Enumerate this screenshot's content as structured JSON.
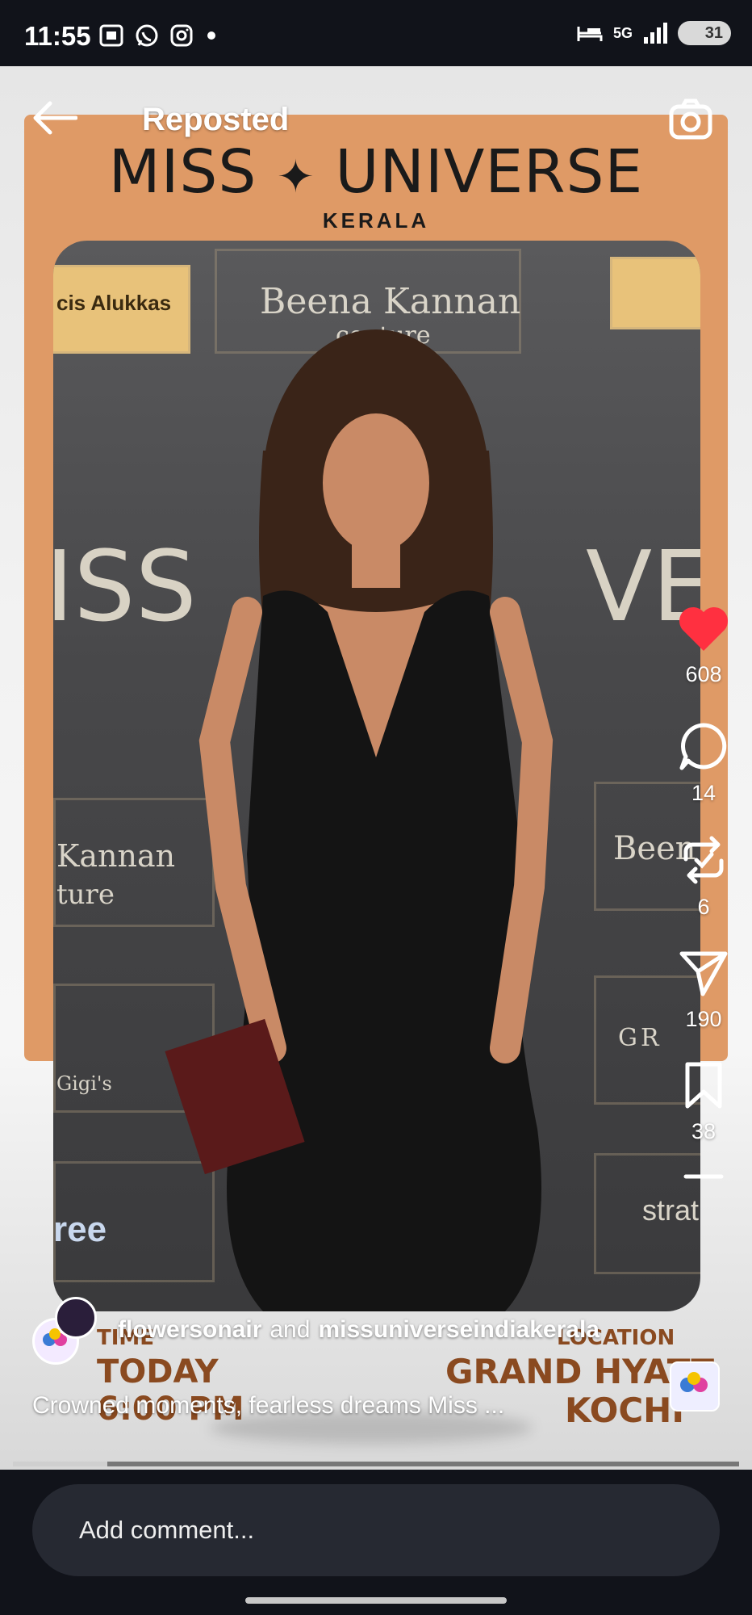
{
  "status_bar": {
    "time": "11:55",
    "network": "5G",
    "battery": "31",
    "icons_left": [
      "screenshot-icon",
      "whatsapp-icon",
      "instagram-icon",
      "dot-icon"
    ],
    "icons_right": [
      "bed-icon",
      "5g-icon",
      "signal-icon",
      "battery-icon"
    ]
  },
  "header": {
    "title": "Reposted"
  },
  "poster": {
    "brand_title": "MISS",
    "brand_title_2": "UNIVERSE",
    "brand_sub": "KERALA",
    "sponsor_1": "cis Alukkas",
    "sponsor_2": "Beena Kannan",
    "sponsor_2_sub": "couture",
    "sponsor_3_left": "Kannan",
    "sponsor_3_left_sub": "ture",
    "sponsor_right_1": "Been",
    "sponsor_right_2": "GR",
    "sponsor_right_3": "strat",
    "sponsor_left_4": "Gigi's",
    "sponsor_left_5": "ree",
    "big_text": "ISS",
    "big_text_right": "VER",
    "time_label": "TIME",
    "time_value_1": "TODAY",
    "time_value_2": "6:00 PM",
    "location_label": "LOCATION",
    "location_value_1": "GRAND HYATT",
    "location_value_2": "KOCHI"
  },
  "actions": {
    "likes": "608",
    "comments": "14",
    "reposts": "6",
    "shares": "190",
    "saves": "38",
    "liked": true,
    "like_color": "#ff3040"
  },
  "author": {
    "name_1": "flowersonair",
    "connector": "and",
    "name_2": "missuniverseindiakerala"
  },
  "caption": "Crowned moments, fearless dreams Miss ...",
  "progress": {
    "fraction": 0.13
  },
  "comment": {
    "placeholder": "Add comment..."
  }
}
